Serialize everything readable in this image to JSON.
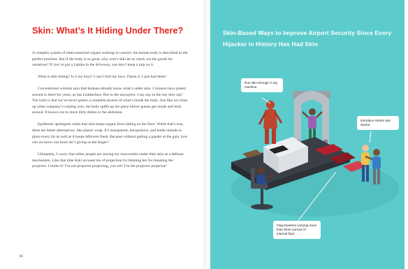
{
  "left_page": {
    "title": "Skin: What’s It Hiding Under There?",
    "paragraphs": [
      "A complex system of interconnected organs working in concert, the human body is described as the perfect machine. But if the body is so great, why won’t skin let us check out the goods for ourselves? If you’ve got a Lambo in the driveway, you don’t keep a tarp on it.",
      "What is skin hiding? Is it my keys? I can’t find my keys. Damn it, I just had them!",
      "Conventional wisdom says that humans already know what’s under skin. Coroners have poked around in there for years, as has Leatherface. But to the naysayers, I say nay to the nay they say! The truth is that we’ve never gotten a complete picture of what’s inside the body. Just like we clean up when company’s coming over, the body spiffs up the place before guests get inside and look around. It knows not to leave dirty dishes in the abdomen.",
      "Epidermic apologists claim that skin keeps organs from falling on the floor. While that’s true, there are better alternatives, like plastic wrap. It’s transparent, inexpensive, and holds innards in place every bit as well as it keeps leftovers fresh. Because without getting a gander at the guts, how can we know our heart isn’t giving us the finger?",
      "Ultimately, I worry that either people are storing my insecurities under their skin as a defense mechanism. Like that time Kiki accused me of projection for blaming her for breaking the projector. I broke it! I’m not projector projecting, you are! I’m the projector projector!"
    ],
    "page_number": "36"
  },
  "right_page": {
    "headline": "Skin-Based Ways to Improve Airport Security Since Every Hijacker in History Has Had Skin",
    "callouts": [
      "Run skin through X-ray machine.",
      "Introduce interior pat-downs.",
      "Flag travelers carrying more than three ounces of internal fluid."
    ]
  },
  "colors": {
    "title_red": "#e2231a",
    "teal_background": "#5ccbcc",
    "headline_white": "#ffffff"
  }
}
